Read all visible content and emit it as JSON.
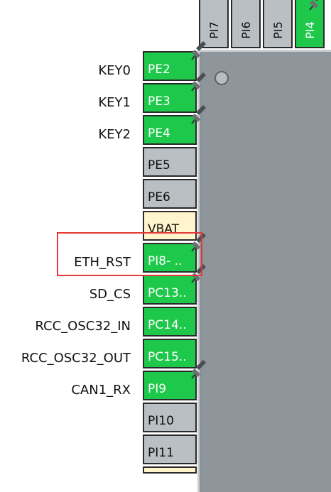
{
  "top_pins": [
    {
      "label": "PI7",
      "state": "gray"
    },
    {
      "label": "PI6",
      "state": "gray"
    },
    {
      "label": "PI5",
      "state": "gray"
    },
    {
      "label": "PI4",
      "state": "green"
    }
  ],
  "left_pins": [
    {
      "label": "PE2",
      "signal": "KEY0",
      "state": "green",
      "pinned": true
    },
    {
      "label": "PE3",
      "signal": "KEY1",
      "state": "green",
      "pinned": true
    },
    {
      "label": "PE4",
      "signal": "KEY2",
      "state": "green",
      "pinned": true
    },
    {
      "label": "PE5",
      "signal": "",
      "state": "gray",
      "pinned": false
    },
    {
      "label": "PE6",
      "signal": "",
      "state": "gray",
      "pinned": false
    },
    {
      "label": "VBAT",
      "signal": "",
      "state": "yellow",
      "pinned": false
    },
    {
      "label": "PI8- ..",
      "signal": "ETH_RST",
      "state": "green",
      "pinned": true
    },
    {
      "label": "PC13..",
      "signal": "SD_CS",
      "state": "green",
      "pinned": true
    },
    {
      "label": "PC14..",
      "signal": "RCC_OSC32_IN",
      "state": "green",
      "pinned": false
    },
    {
      "label": "PC15..",
      "signal": "RCC_OSC32_OUT",
      "state": "green",
      "pinned": false
    },
    {
      "label": "PI9",
      "signal": "CAN1_RX",
      "state": "green",
      "pinned": true
    },
    {
      "label": "PI10",
      "signal": "",
      "state": "gray",
      "pinned": false
    },
    {
      "label": "PI11",
      "signal": "",
      "state": "gray",
      "pinned": false
    }
  ],
  "colors": {
    "assigned": "#1ec84a",
    "unassigned": "#b9bfc3",
    "power": "#fff4cc",
    "highlight": "#e53935"
  }
}
